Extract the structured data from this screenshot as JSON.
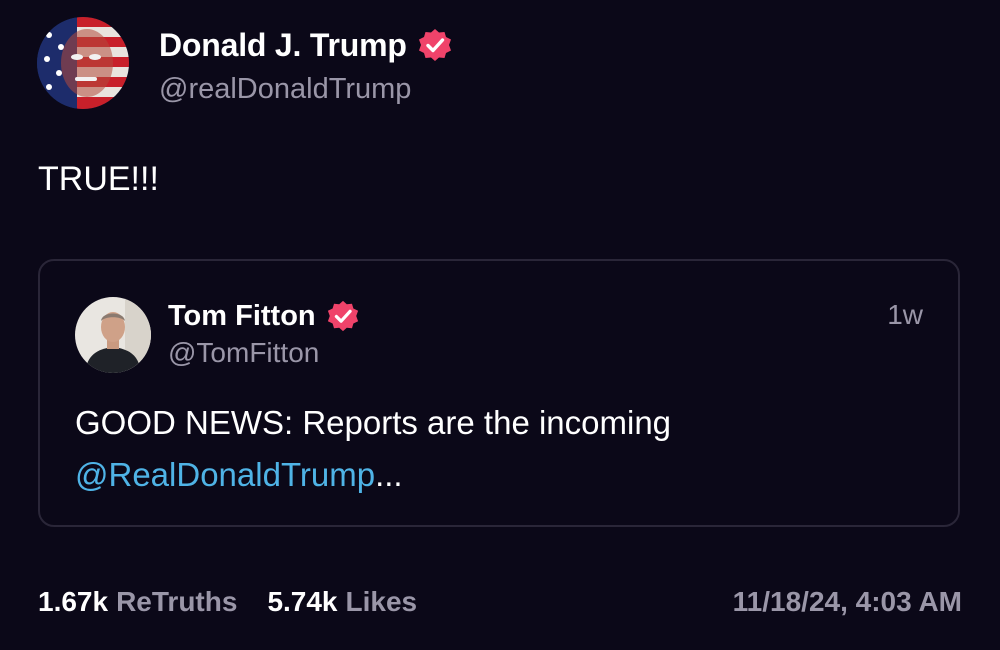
{
  "post": {
    "author": {
      "display_name": "Donald J. Trump",
      "handle": "@realDonaldTrump",
      "verified": true,
      "avatar": "flag-painted-portrait"
    },
    "body": "TRUE!!!",
    "quote": {
      "author": {
        "display_name": "Tom Fitton",
        "handle": "@TomFitton",
        "verified": true,
        "avatar": "man-portrait"
      },
      "time_ago": "1w",
      "text_before": "GOOD NEWS: Reports are the incoming",
      "mention": "@RealDonaldTrump",
      "ellipsis": "..."
    },
    "stats": {
      "retruths_count": "1.67k",
      "retruths_label": "ReTruths",
      "likes_count": "5.74k",
      "likes_label": "Likes"
    },
    "timestamp": "11/18/24, 4:03 AM"
  },
  "colors": {
    "background": "#0b0818",
    "secondary_text": "#9a96a8",
    "mention": "#4fb3e6",
    "verified_badge": "#f0436a",
    "card_border": "#2a2638"
  }
}
